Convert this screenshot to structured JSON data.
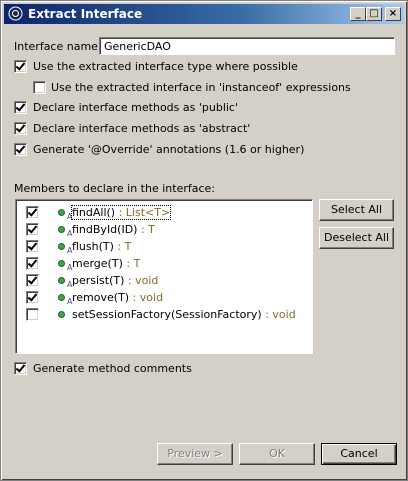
{
  "window": {
    "title": "Extract Interface"
  },
  "interface_name": {
    "label": "Interface name:",
    "value": "GenericDAO"
  },
  "options": [
    {
      "label": "Use the extracted interface type where possible",
      "checked": true
    },
    {
      "label": "Use the extracted interface in 'instanceof' expressions",
      "checked": false
    },
    {
      "label": "Declare interface methods as 'public'",
      "checked": true
    },
    {
      "label": "Declare interface methods as 'abstract'",
      "checked": true
    },
    {
      "label": "Generate '@Override' annotations (1.6 or higher)",
      "checked": true
    }
  ],
  "members": {
    "label": "Members to declare in the interface:",
    "items": [
      {
        "name": "findAll()",
        "type": " : List<T>",
        "checked": true,
        "abstract": true
      },
      {
        "name": "findById(ID)",
        "type": " : T",
        "checked": true,
        "abstract": true
      },
      {
        "name": "flush(T)",
        "type": " : T",
        "checked": true,
        "abstract": true
      },
      {
        "name": "merge(T)",
        "type": " : T",
        "checked": true,
        "abstract": true
      },
      {
        "name": "persist(T)",
        "type": " : void",
        "checked": true,
        "abstract": true
      },
      {
        "name": "remove(T)",
        "type": " : void",
        "checked": true,
        "abstract": true
      },
      {
        "name": "setSessionFactory(SessionFactory)",
        "type": " : void",
        "checked": false,
        "abstract": false
      }
    ]
  },
  "buttons": {
    "select_all": "Select All",
    "deselect_all": "Deselect All",
    "preview": "Preview >",
    "ok": "OK",
    "cancel": "Cancel"
  },
  "generate_comments": {
    "label": "Generate method comments",
    "checked": true
  }
}
